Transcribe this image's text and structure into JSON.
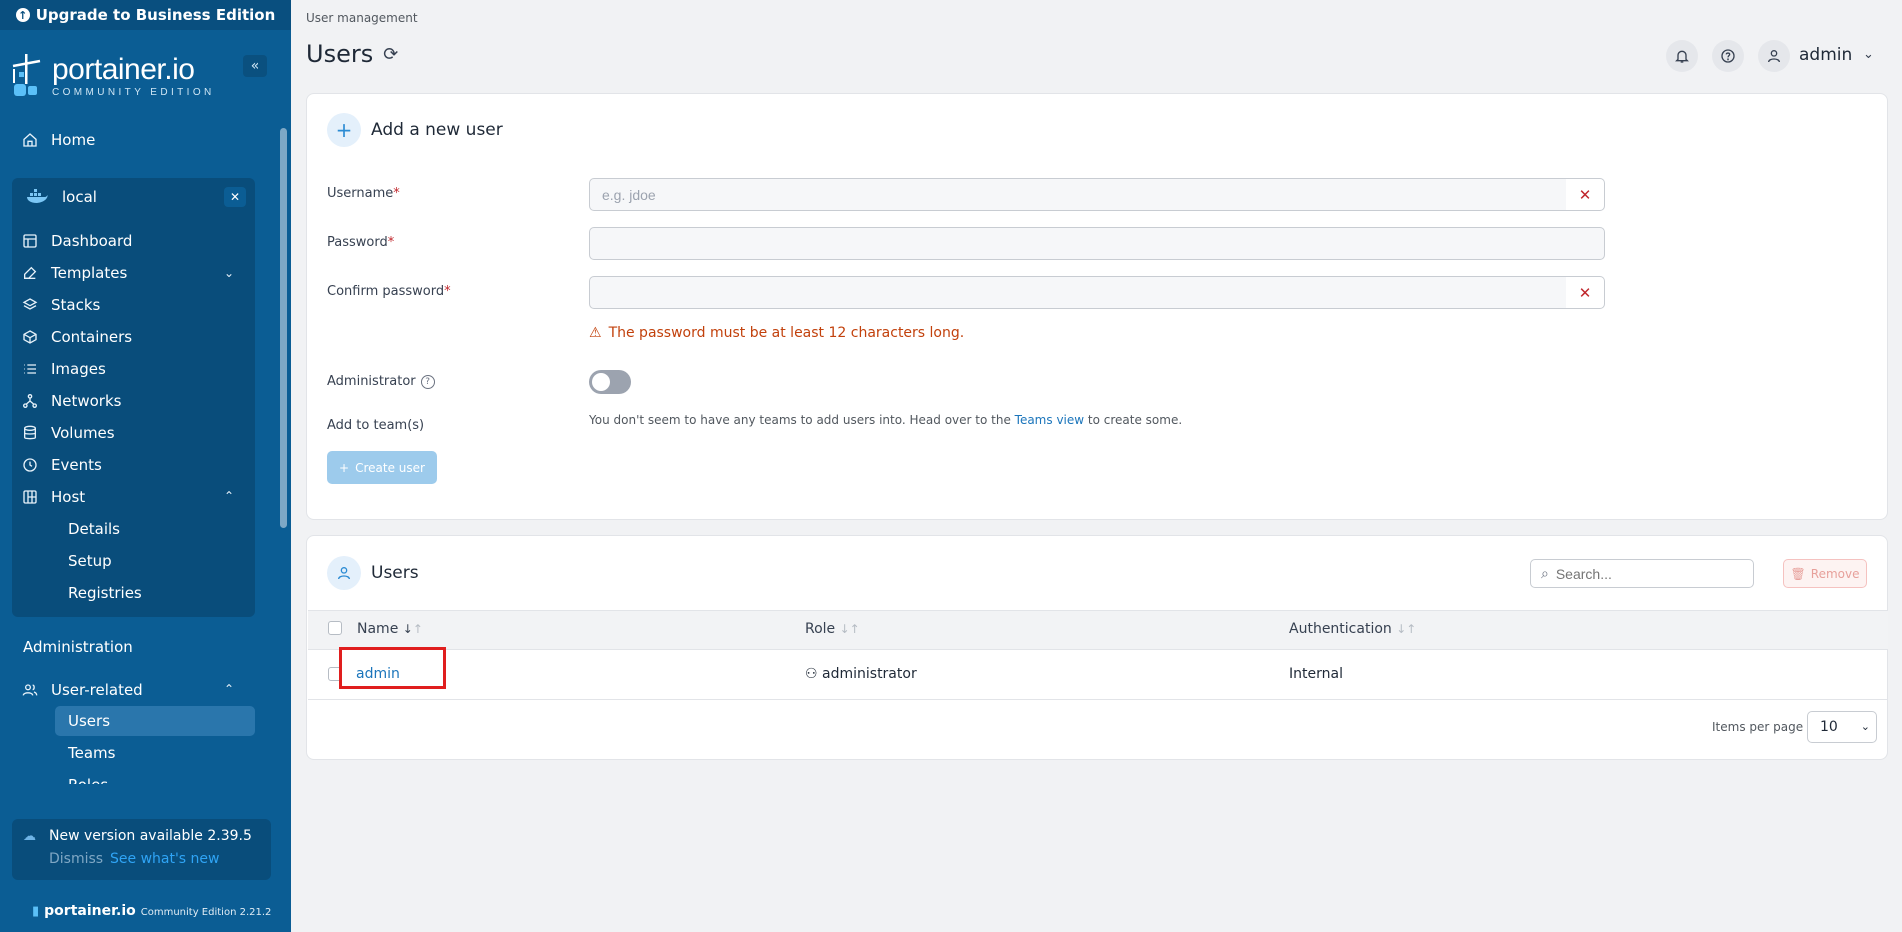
{
  "sidebar": {
    "upgrade": "Upgrade to Business Edition",
    "logo_name": "portainer.io",
    "logo_sub": "COMMUNITY EDITION",
    "home": "Home",
    "env_name": "local",
    "env_items": [
      {
        "label": "Dashboard",
        "icon": "dashboard-icon"
      },
      {
        "label": "Templates",
        "icon": "edit-icon"
      },
      {
        "label": "Stacks",
        "icon": "layers-icon"
      },
      {
        "label": "Containers",
        "icon": "box-icon"
      },
      {
        "label": "Images",
        "icon": "list-icon"
      },
      {
        "label": "Networks",
        "icon": "network-icon"
      },
      {
        "label": "Volumes",
        "icon": "database-icon"
      },
      {
        "label": "Events",
        "icon": "history-icon"
      },
      {
        "label": "Host",
        "icon": "grid-icon"
      }
    ],
    "host_sub": [
      "Details",
      "Setup",
      "Registries"
    ],
    "administration": "Administration",
    "user_related": "User-related",
    "user_sub": [
      "Users",
      "Teams",
      "Roles"
    ],
    "update_title": "New version available 2.39.5",
    "dismiss": "Dismiss",
    "whats_new": "See what's new",
    "footer_name": "portainer.io",
    "footer_version": "Community Edition 2.21.2"
  },
  "header": {
    "breadcrumb": "User management",
    "title": "Users",
    "user": "admin"
  },
  "add_user": {
    "title": "Add a new user",
    "username_label": "Username",
    "username_placeholder": "e.g. jdoe",
    "password_label": "Password",
    "confirm_label": "Confirm password",
    "warning": "The password must be at least 12 characters long.",
    "administrator_label": "Administrator",
    "teams_label": "Add to team(s)",
    "teams_note_pre": "You don't seem to have any teams to add users into. Head over to the",
    "teams_link": "Teams view",
    "teams_note_post": "to create some.",
    "create_button": "Create user"
  },
  "users_table": {
    "title": "Users",
    "search_placeholder": "Search...",
    "remove_button": "Remove",
    "columns": [
      "Name",
      "Role",
      "Authentication"
    ],
    "rows": [
      {
        "name": "admin",
        "role": "administrator",
        "auth": "Internal"
      }
    ],
    "items_per_page_label": "Items per page",
    "items_per_page": "10"
  }
}
